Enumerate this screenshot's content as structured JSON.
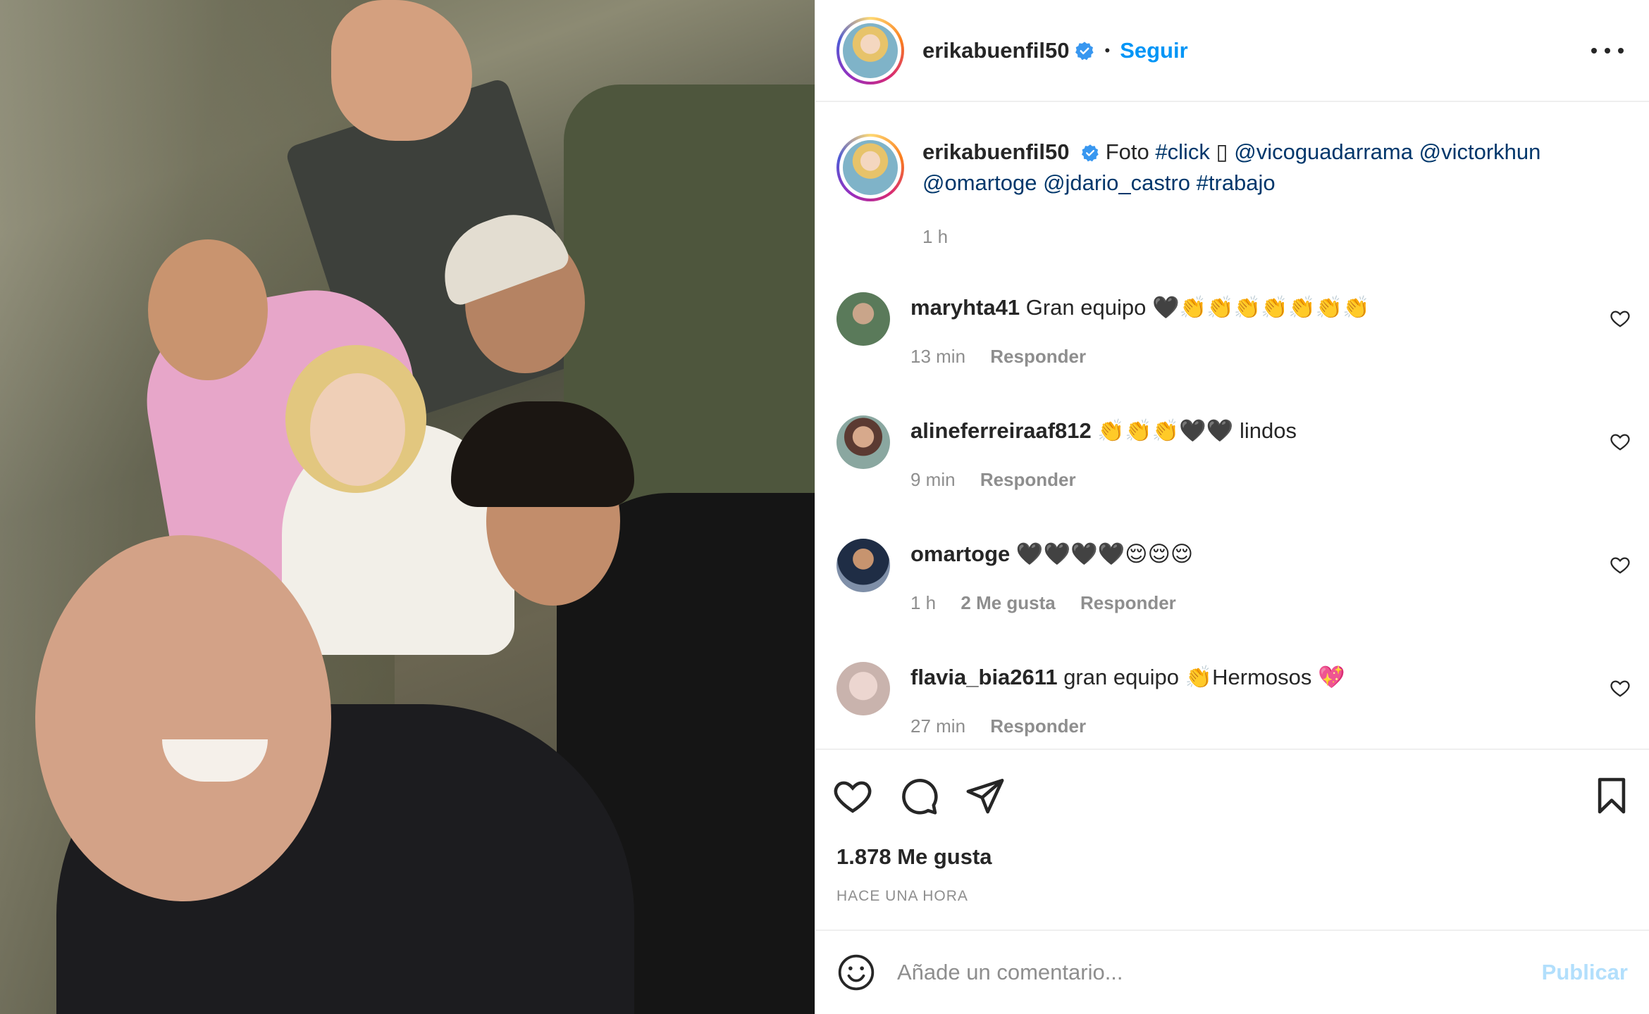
{
  "header": {
    "username": "erikabuenfil50",
    "separator": "•",
    "follow_label": "Seguir"
  },
  "caption": {
    "username": "erikabuenfil50",
    "text_word": "Foto",
    "hashtag1": "#click",
    "glyph": "▯",
    "mention1": "@vicoguadarrama",
    "mention2": "@victorkhun",
    "mention3": "@omartoge",
    "mention4": "@jdario_castro",
    "hashtag2": "#trabajo",
    "time": "1 h"
  },
  "comments": [
    {
      "username": "maryhta41",
      "text": "Gran equipo 🖤👏👏👏👏👏👏👏",
      "time": "13 min",
      "reply": "Responder",
      "likes": "",
      "avatar_color": "#5a7a5a"
    },
    {
      "username": "alineferreiraaf812",
      "text": "👏👏👏🖤🖤 lindos",
      "time": "9 min",
      "reply": "Responder",
      "likes": "",
      "avatar_color": "#8a6a5a"
    },
    {
      "username": "omartoge",
      "text": "🖤🖤🖤🖤😌😌😌",
      "time": "1 h",
      "reply": "Responder",
      "likes": "2 Me gusta",
      "avatar_color": "#2f4a6e"
    },
    {
      "username": "flavia_bia2611",
      "text": "gran equipo 👏Hermosos 💖",
      "time": "27 min",
      "reply": "Responder",
      "likes": "",
      "avatar_color": "#d8c8c4"
    }
  ],
  "footer": {
    "likes": "1.878 Me gusta",
    "when": "HACE UNA HORA"
  },
  "add_comment": {
    "placeholder": "Añade un comentario...",
    "publish_label": "Publicar"
  },
  "colors": {
    "accent": "#0095f6",
    "verified": "#3897f0",
    "link": "#00376b",
    "muted": "#8e8e8e"
  }
}
